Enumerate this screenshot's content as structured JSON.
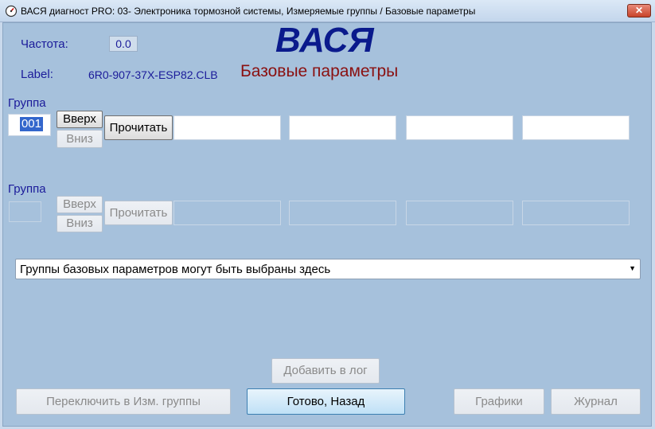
{
  "window": {
    "title": "ВАСЯ диагност PRO: 03- Электроника тормозной системы,  Измеряемые группы / Базовые параметры",
    "close_label": "✕"
  },
  "header": {
    "freq_label": "Частота:",
    "freq_value": "0.0",
    "label_label": "Label:",
    "label_value": "6R0-907-37X-ESP82.CLB",
    "app_title": "ВАСЯ",
    "page_subtitle": "Базовые параметры"
  },
  "group1": {
    "label": "Группа",
    "value": "001",
    "up_label": "Вверх",
    "down_label": "Вниз",
    "read_label": "Прочитать",
    "fields": [
      "",
      "",
      "",
      ""
    ]
  },
  "group2": {
    "label": "Группа",
    "value": "",
    "up_label": "Вверх",
    "down_label": "Вниз",
    "read_label": "Прочитать",
    "fields": [
      "",
      "",
      "",
      ""
    ]
  },
  "group_select": {
    "selected": "Группы базовых параметров могут быть выбраны здесь"
  },
  "footer": {
    "add_log_label": "Добавить в лог",
    "switch_label": "Переключить в Изм. группы",
    "done_label": "Готово, Назад",
    "graphs_label": "Графики",
    "journal_label": "Журнал"
  },
  "colors": {
    "client_bg": "#a6c1dc",
    "title_blue": "#0a1a8c",
    "subtitle_red": "#8a1010",
    "label_blue": "#1b1b9a"
  }
}
